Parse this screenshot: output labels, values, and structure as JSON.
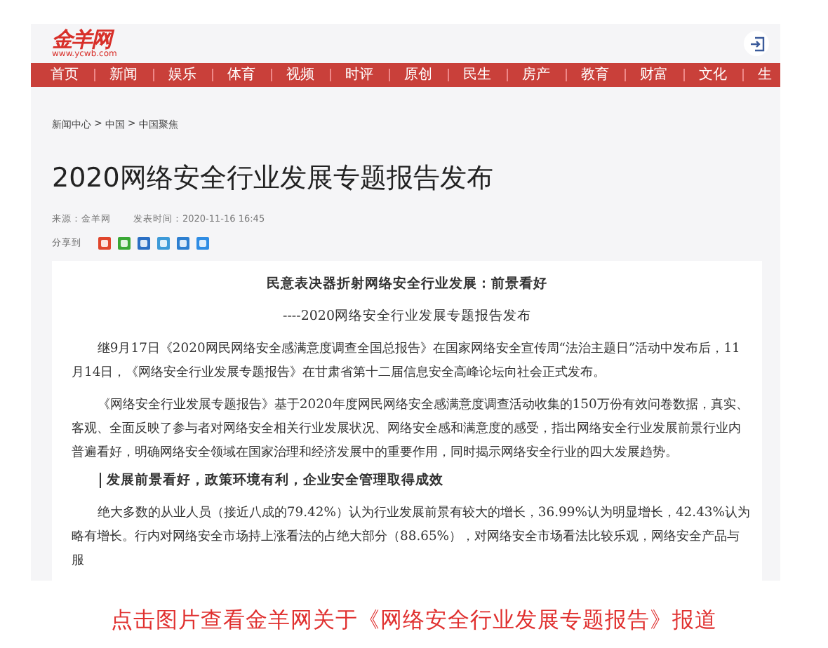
{
  "site": {
    "logo": "金羊网",
    "domain": "www.ycwb.com"
  },
  "nav": [
    "首页",
    "新闻",
    "娱乐",
    "体育",
    "视频",
    "时评",
    "原创",
    "民生",
    "房产",
    "教育",
    "财富",
    "文化",
    "生"
  ],
  "breadcrumb": {
    "items": [
      "新闻中心",
      "中国",
      "中国聚焦"
    ],
    "separator": ">"
  },
  "article": {
    "title": "2020网络安全行业发展专题报告发布",
    "source": "来源：金羊网",
    "time": "发表时间：2020-11-16 16:45",
    "share_label": "分享到",
    "body": [
      {
        "kind": "heading",
        "text": "民意表决器折射网络安全行业发展：前景看好"
      },
      {
        "kind": "subheading",
        "text": "----2020网络安全行业发展专题报告发布"
      },
      {
        "kind": "paragraph",
        "text": "继9月17日《2020网民网络安全感满意度调查全国总报告》在国家网络安全宣传周“法治主题日”活动中发布后，11月14日，《网络安全行业发展专题报告》在甘肃省第十二届信息安全高峰论坛向社会正式发布。"
      },
      {
        "kind": "paragraph",
        "text": "《网络安全行业发展专题报告》基于2020年度网民网络安全感满意度调查活动收集的150万份有效问卷数据，真实、客观、全面反映了参与者对网络安全相关行业发展状况、网络安全感和满意度的感受，指出网络安全行业发展前景行业内普遍看好，明确网络安全领域在国家治理和经济发展中的重要作用，同时揭示网络安全行业的四大发展趋势。"
      },
      {
        "kind": "section",
        "text": "发展前景看好，政策环境有利，企业安全管理取得成效"
      },
      {
        "kind": "paragraph",
        "text": "绝大多数的从业人员（接近八成的79.42%）认为行业发展前景有较大的增长，36.99%认为明显增长，42.43%认为略有增长。行内对网络安全市场持上涨看法的占绝大部分（88.65%），对网络安全市场看法比较乐观，网络安全产品与服"
      }
    ]
  },
  "caption": "点击图片查看金羊网关于《网络安全行业发展专题报告》报道"
}
